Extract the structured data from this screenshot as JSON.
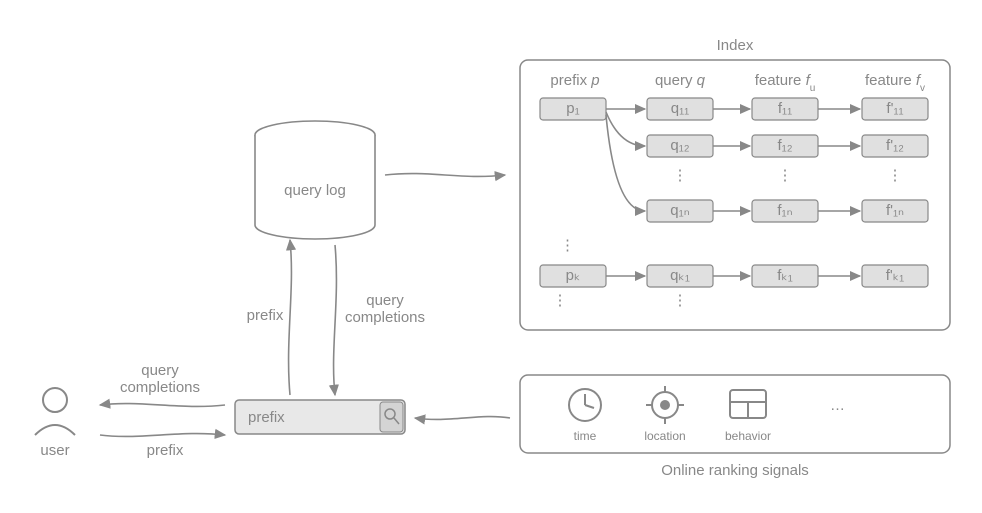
{
  "user_lbl": "user",
  "query_comp": "query\ncompletions",
  "prefix_word": "prefix",
  "search_input": "prefix",
  "query_log": "query log",
  "index_title": "Index",
  "col_p": "prefix p",
  "col_q": "query q",
  "col_fu": "feature f_u",
  "col_fv": "feature f_v",
  "cell_p1": "p₁",
  "cell_pk": "pₖ",
  "cell_q11": "q₁₁",
  "cell_q12": "q₁₂",
  "cell_q1n": "q₁ₙ",
  "cell_qk1": "qₖ₁",
  "cell_f11": "f₁₁",
  "cell_f12": "f₁₂",
  "cell_f1n": "f₁ₙ",
  "cell_fk1": "fₖ₁",
  "cell_fp11": "f'₁₁",
  "cell_fp12": "f'₁₂",
  "cell_fp1n": "f'₁ₙ",
  "cell_fpk1": "f'ₖ₁",
  "dots": "⋮",
  "hdots": "…",
  "signals_title": "Online ranking signals",
  "sig_time": "time",
  "sig_loc": "location",
  "sig_beh": "behavior"
}
